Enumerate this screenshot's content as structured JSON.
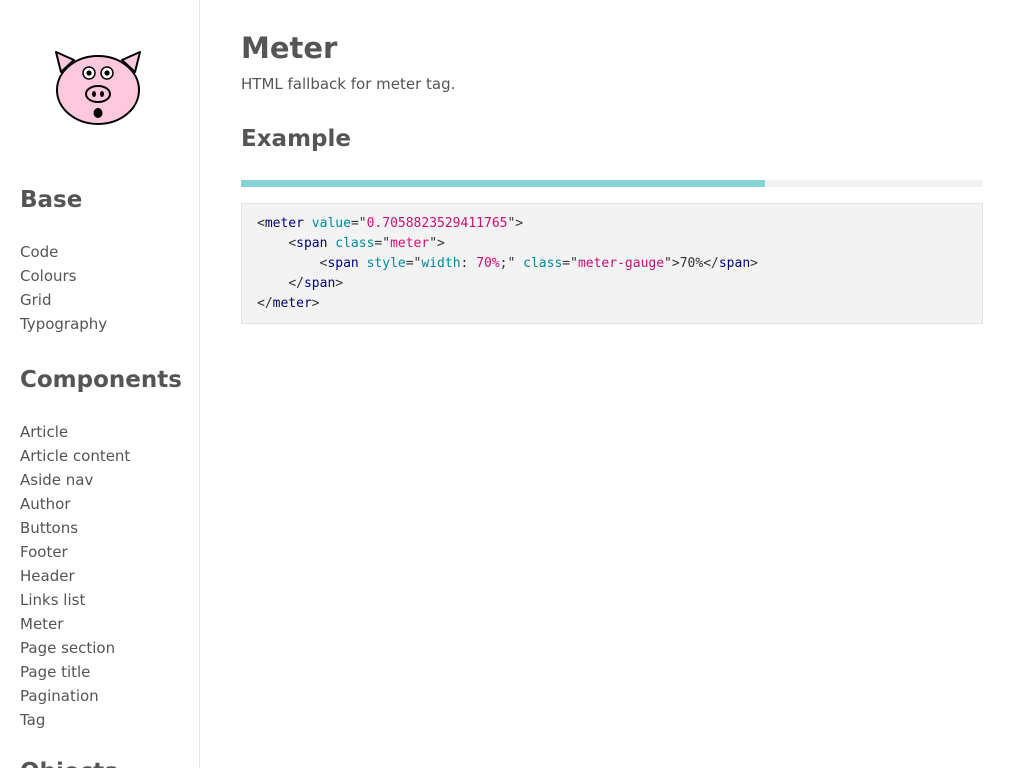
{
  "sidebar": {
    "logo_name": "pig-face",
    "groups": [
      {
        "heading": "Base",
        "items": [
          "Code",
          "Colours",
          "Grid",
          "Typography"
        ]
      },
      {
        "heading": "Components",
        "items": [
          "Article",
          "Article content",
          "Aside nav",
          "Author",
          "Buttons",
          "Footer",
          "Header",
          "Links list",
          "Meter",
          "Page section",
          "Page title",
          "Pagination",
          "Tag"
        ]
      },
      {
        "heading": "Objects"
      }
    ]
  },
  "main": {
    "title": "Meter",
    "description": "HTML fallback for meter tag.",
    "section_title": "Example",
    "meter": {
      "value": 0.7058823529411765,
      "percent_label": "70%"
    },
    "code": {
      "line1": {
        "open": "<",
        "tag": "meter",
        "attr": "value",
        "eq": "=\"",
        "val": "0.7058823529411765",
        "close": "\">"
      },
      "line2": {
        "open": "<",
        "tag": "span",
        "attr": "class",
        "eq": "=\"",
        "val": "meter",
        "close": "\">"
      },
      "line3": {
        "open": "<",
        "tag": "span",
        "attr": "style",
        "eq": "=\"",
        "prop": "width",
        "colon": ": ",
        "propval": "70%",
        "semi": ";\" ",
        "attr2": "class",
        "eq2": "=\"",
        "val2": "meter-gauge",
        "close2": "\">",
        "text": "70%",
        "endopen": "</",
        "endtag": "span",
        "endclose": ">"
      },
      "line4": {
        "open": "</",
        "tag": "span",
        "close": ">"
      },
      "line5": {
        "open": "</",
        "tag": "meter",
        "close": ">"
      }
    }
  },
  "colors": {
    "meter_fill": "#86d4d8",
    "meter_track": "#f2f2f2",
    "code_bg": "#f3f3f3",
    "text": "#555555"
  }
}
